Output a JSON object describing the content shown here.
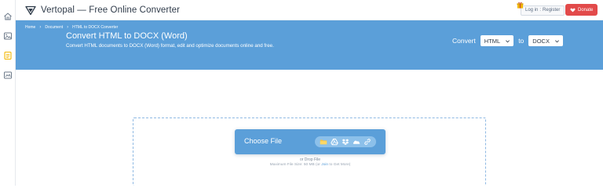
{
  "header": {
    "title": "Vertopal — Free Online Converter",
    "login_label": "Log in",
    "separator": ":",
    "register_label": "Register",
    "donate_label": "Donate"
  },
  "sidebar": {
    "icons": [
      "home-icon",
      "image-icon",
      "document-icon",
      "media-icon"
    ],
    "active_index": 2
  },
  "breadcrumb": {
    "items": [
      "Home",
      "Document",
      "HTML to DOCX Converter"
    ]
  },
  "hero": {
    "title": "Convert HTML to DOCX (Word)",
    "subtitle": "Convert HTML documents to DOCX (Word) format, edit and optimize documents online and free."
  },
  "converter": {
    "convert_label": "Convert",
    "from_value": "HTML",
    "to_label": "to",
    "to_value": "DOCX"
  },
  "upload": {
    "choose_label": "Choose File",
    "source_icons": [
      "folder-icon",
      "google-drive-icon",
      "dropbox-icon",
      "onedrive-icon",
      "link-icon"
    ],
    "drop_hint": "or Drop File",
    "max_size_prefix": "Maximum File Size: 50 MB (or",
    "max_size_link": "Join",
    "max_size_suffix": "to Get More)"
  },
  "colors": {
    "accent": "#5b9fd9",
    "donate": "#e24a4a",
    "active_rail_icon": "#f2b705"
  }
}
